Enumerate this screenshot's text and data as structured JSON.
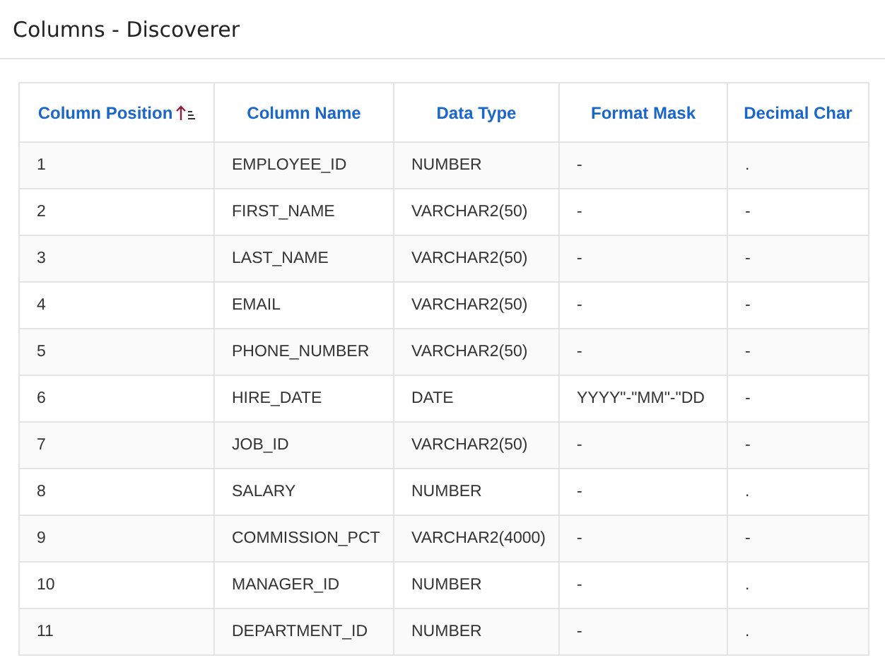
{
  "page": {
    "title": "Columns - Discoverer"
  },
  "table": {
    "columns": [
      {
        "label": "Column Position",
        "sorted": true
      },
      {
        "label": "Column Name",
        "sorted": false
      },
      {
        "label": "Data Type",
        "sorted": false
      },
      {
        "label": "Format Mask",
        "sorted": false
      },
      {
        "label": "Decimal Char",
        "sorted": false
      }
    ],
    "rows": [
      [
        "1",
        "EMPLOYEE_ID",
        "NUMBER",
        "-",
        "."
      ],
      [
        "2",
        "FIRST_NAME",
        "VARCHAR2(50)",
        "-",
        "-"
      ],
      [
        "3",
        "LAST_NAME",
        "VARCHAR2(50)",
        "-",
        "-"
      ],
      [
        "4",
        "EMAIL",
        "VARCHAR2(50)",
        "-",
        "-"
      ],
      [
        "5",
        "PHONE_NUMBER",
        "VARCHAR2(50)",
        "-",
        "-"
      ],
      [
        "6",
        "HIRE_DATE",
        "DATE",
        "YYYY\"-\"MM\"-\"DD",
        "-"
      ],
      [
        "7",
        "JOB_ID",
        "VARCHAR2(50)",
        "-",
        "-"
      ],
      [
        "8",
        "SALARY",
        "NUMBER",
        "-",
        "."
      ],
      [
        "9",
        "COMMISSION_PCT",
        "VARCHAR2(4000)",
        "-",
        "-"
      ],
      [
        "10",
        "MANAGER_ID",
        "NUMBER",
        "-",
        "."
      ],
      [
        "11",
        "DEPARTMENT_ID",
        "NUMBER",
        "-",
        "."
      ]
    ]
  }
}
